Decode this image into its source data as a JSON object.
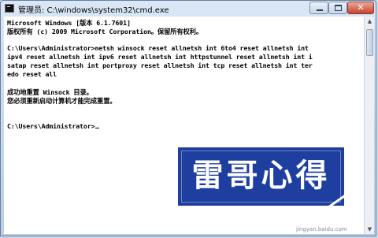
{
  "window": {
    "title": "管理员: C:\\windows\\system32\\cmd.exe",
    "close_glyph": "✕"
  },
  "console": {
    "lines": [
      "Microsoft Windows [版本 6.1.7601]",
      "版权所有 (c) 2009 Microsoft Corporation。保留所有权利。",
      "",
      "C:\\Users\\Administrator>netsh winsock reset allnetsh int 6to4 reset allnetsh int",
      "ipv4 reset allnetsh int ipv6 reset allnetsh int httpstunnel reset allnetsh int i",
      "satap reset allnetsh int portproxy reset allnetsh int tcp reset allnetsh int ter",
      "edo reset all",
      "",
      "成功地重置 Winsock 目录。",
      "您必须重新启动计算机才能完成重置。",
      "",
      "",
      "C:\\Users\\Administrator>"
    ]
  },
  "badge": {
    "text": "雷哥心得"
  },
  "watermark": "jingyan.baidu.com",
  "colors": {
    "badge_bg": "#1f3fa0",
    "console_bg": "#ffffff",
    "close_red": "#c8412b"
  },
  "icons": [
    "cmd-icon",
    "minimize-icon",
    "maximize-icon",
    "close-icon",
    "scroll-up-icon",
    "scroll-down-icon"
  ]
}
